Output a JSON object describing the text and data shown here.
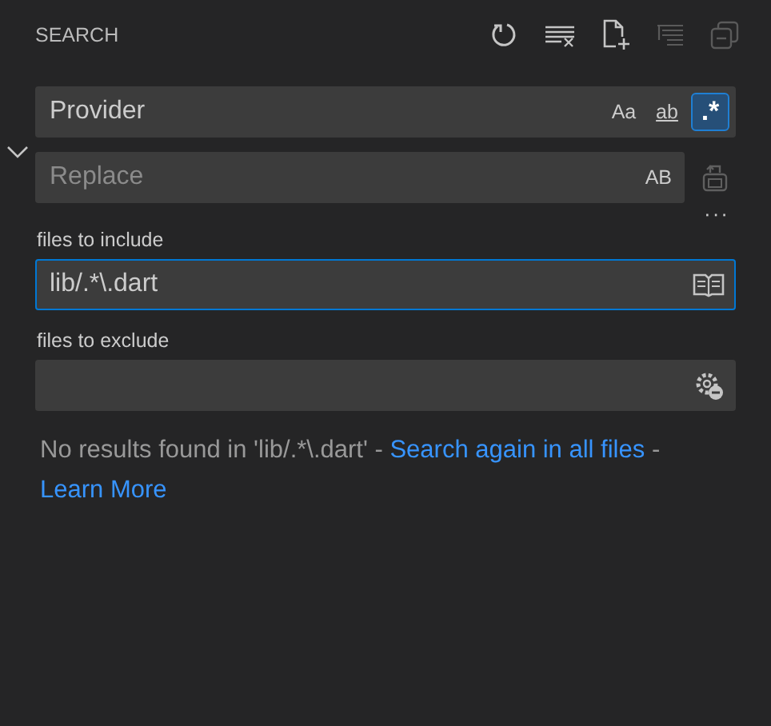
{
  "panel": {
    "title": "SEARCH"
  },
  "toolbar": [
    {
      "kind": "refresh",
      "disabled": false
    },
    {
      "kind": "clear",
      "disabled": false
    },
    {
      "kind": "new-file",
      "disabled": false
    },
    {
      "kind": "tree",
      "disabled": true
    },
    {
      "kind": "collapse",
      "disabled": true
    }
  ],
  "replace_expanded": true,
  "search": {
    "value": "Provider",
    "toggles": [
      {
        "label": "Aa",
        "kind": "case",
        "selected": false
      },
      {
        "label": "ab",
        "kind": "word",
        "selected": false
      },
      {
        "label": ".*",
        "kind": "regex",
        "selected": true
      }
    ]
  },
  "replace": {
    "placeholder": "Replace",
    "toggle": {
      "label": "AB",
      "selected": false
    },
    "replace_all_disabled": true
  },
  "more": "···",
  "include": {
    "label": "files to include",
    "value": "lib/.*\\.dart",
    "focused": true
  },
  "exclude": {
    "label": "files to exclude"
  },
  "message": [
    {
      "kind": "text",
      "text": "No results found in 'lib/.*\\.dart' -"
    },
    {
      "kind": "link",
      "text": "Search again in all files"
    },
    {
      "kind": "text",
      "text": "-"
    },
    {
      "kind": "link",
      "text": "Learn More"
    }
  ]
}
